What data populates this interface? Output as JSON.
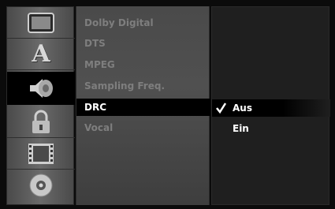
{
  "icons": [
    {
      "name": "display-icon"
    },
    {
      "name": "language-icon",
      "glyph": "A"
    },
    {
      "name": "audio-speaker-icon"
    },
    {
      "name": "lock-icon"
    },
    {
      "name": "film-icon"
    },
    {
      "name": "disc-icon"
    }
  ],
  "menu": {
    "items": [
      {
        "label": "Dolby Digital"
      },
      {
        "label": "DTS"
      },
      {
        "label": "MPEG"
      },
      {
        "label": "Sampling Freq."
      },
      {
        "label": "DRC"
      },
      {
        "label": "Vocal"
      }
    ],
    "active_index": 4
  },
  "submenu": {
    "options": [
      {
        "label": "Aus",
        "selected": true
      },
      {
        "label": "Ein",
        "selected": false
      }
    ]
  },
  "colors": {
    "active_bg": "#000000",
    "active_text": "#ffffff",
    "inactive_text": "#7e7e7e"
  }
}
